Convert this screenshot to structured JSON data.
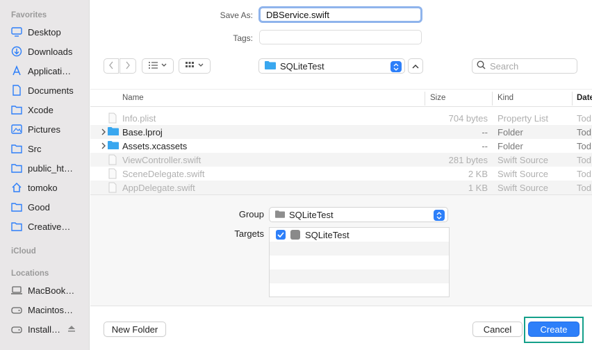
{
  "sidebar": {
    "favorites_heading": "Favorites",
    "favorites": [
      {
        "label": "Desktop",
        "icon": "desktop-icon"
      },
      {
        "label": "Downloads",
        "icon": "downloads-icon"
      },
      {
        "label": "Applicati…",
        "icon": "applications-icon"
      },
      {
        "label": "Documents",
        "icon": "document-icon"
      },
      {
        "label": "Xcode",
        "icon": "folder-icon"
      },
      {
        "label": "Pictures",
        "icon": "pictures-icon"
      },
      {
        "label": "Src",
        "icon": "folder-icon"
      },
      {
        "label": "public_ht…",
        "icon": "folder-icon"
      },
      {
        "label": "tomoko",
        "icon": "home-icon"
      },
      {
        "label": "Good",
        "icon": "folder-icon"
      },
      {
        "label": "Creative…",
        "icon": "folder-icon"
      }
    ],
    "icloud_heading": "iCloud",
    "locations_heading": "Locations",
    "locations": [
      {
        "label": "MacBook…",
        "icon": "laptop-icon"
      },
      {
        "label": "Macintos…",
        "icon": "disk-icon"
      },
      {
        "label": "Install…",
        "icon": "disk-icon"
      }
    ]
  },
  "save": {
    "save_as_label": "Save As:",
    "filename": "DBService.swift",
    "tags_label": "Tags:"
  },
  "toolbar": {
    "location": "SQLiteTest",
    "search_placeholder": "Search"
  },
  "table": {
    "columns": [
      "Name",
      "Size",
      "Kind",
      "Date"
    ],
    "rows": [
      {
        "name": "Info.plist",
        "size": "704 bytes",
        "kind": "Property List",
        "date": "Tod",
        "type": "file",
        "dim": true
      },
      {
        "name": "Base.lproj",
        "size": "--",
        "kind": "Folder",
        "date": "Tod",
        "type": "folder",
        "dim": false
      },
      {
        "name": "Assets.xcassets",
        "size": "--",
        "kind": "Folder",
        "date": "Tod",
        "type": "folder",
        "dim": false
      },
      {
        "name": "ViewController.swift",
        "size": "281 bytes",
        "kind": "Swift Source",
        "date": "Tod",
        "type": "file",
        "dim": true
      },
      {
        "name": "SceneDelegate.swift",
        "size": "2 KB",
        "kind": "Swift Source",
        "date": "Tod",
        "type": "file",
        "dim": true
      },
      {
        "name": "AppDelegate.swift",
        "size": "1 KB",
        "kind": "Swift Source",
        "date": "Tod",
        "type": "file",
        "dim": true
      }
    ]
  },
  "options": {
    "group_label": "Group",
    "group_value": "SQLiteTest",
    "targets_label": "Targets",
    "targets": [
      {
        "name": "SQLiteTest",
        "checked": true
      }
    ]
  },
  "buttons": {
    "new_folder": "New Folder",
    "cancel": "Cancel",
    "create": "Create"
  },
  "colors": {
    "accent": "#2d7ff9",
    "highlight": "#14a08a"
  }
}
